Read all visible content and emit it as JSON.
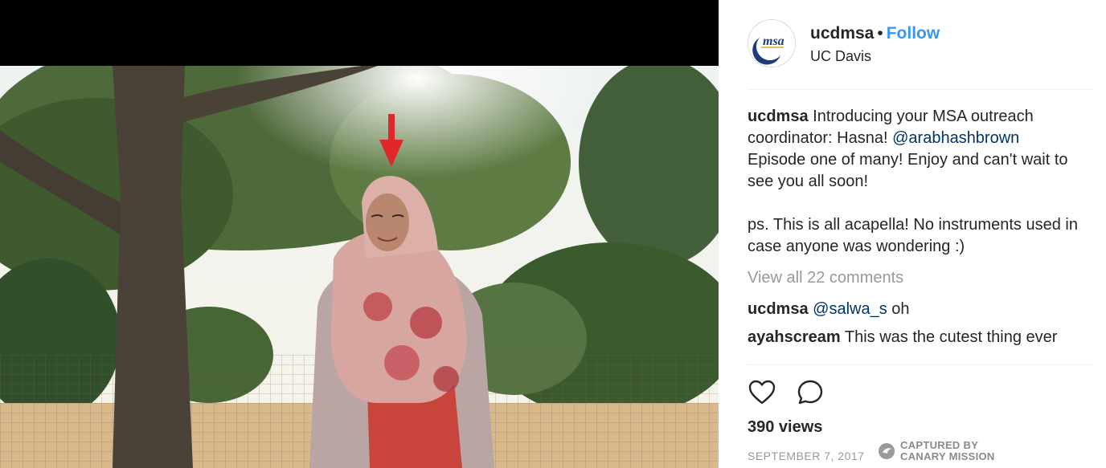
{
  "post": {
    "username": "ucdmsa",
    "separator": "•",
    "follow_label": "Follow",
    "location": "UC Davis",
    "avatar_logo_text": "msa"
  },
  "caption": {
    "username": "ucdmsa",
    "text_before": " Introducing your MSA outreach coordinator: Hasna! ",
    "mention": "@arabhashbrown",
    "text_after": "\nEpisode one of many! Enjoy and can't wait to see you all soon!\n\nps. This is all acapella! No instruments used in case anyone was wondering :)"
  },
  "view_all_comments": "View all 22 comments",
  "comments": [
    {
      "username": "ucdmsa",
      "mention": "@salwa_s",
      "text": " oh"
    },
    {
      "username": "ayahscream",
      "mention": "",
      "text": " This was the cutest thing ever"
    }
  ],
  "actions": {
    "like_icon": "heart-icon",
    "comment_icon": "comment-bubble-icon"
  },
  "stats": {
    "views": "390 views",
    "date": "SEPTEMBER 7, 2017"
  },
  "watermark": {
    "icon": "canary-logo-icon",
    "text": "CAPTURED BY\nCANARY MISSION"
  },
  "colors": {
    "link_blue": "#3897f0",
    "mention_blue": "#003569",
    "muted_gray": "#999999",
    "arrow_red": "#e0282a"
  }
}
